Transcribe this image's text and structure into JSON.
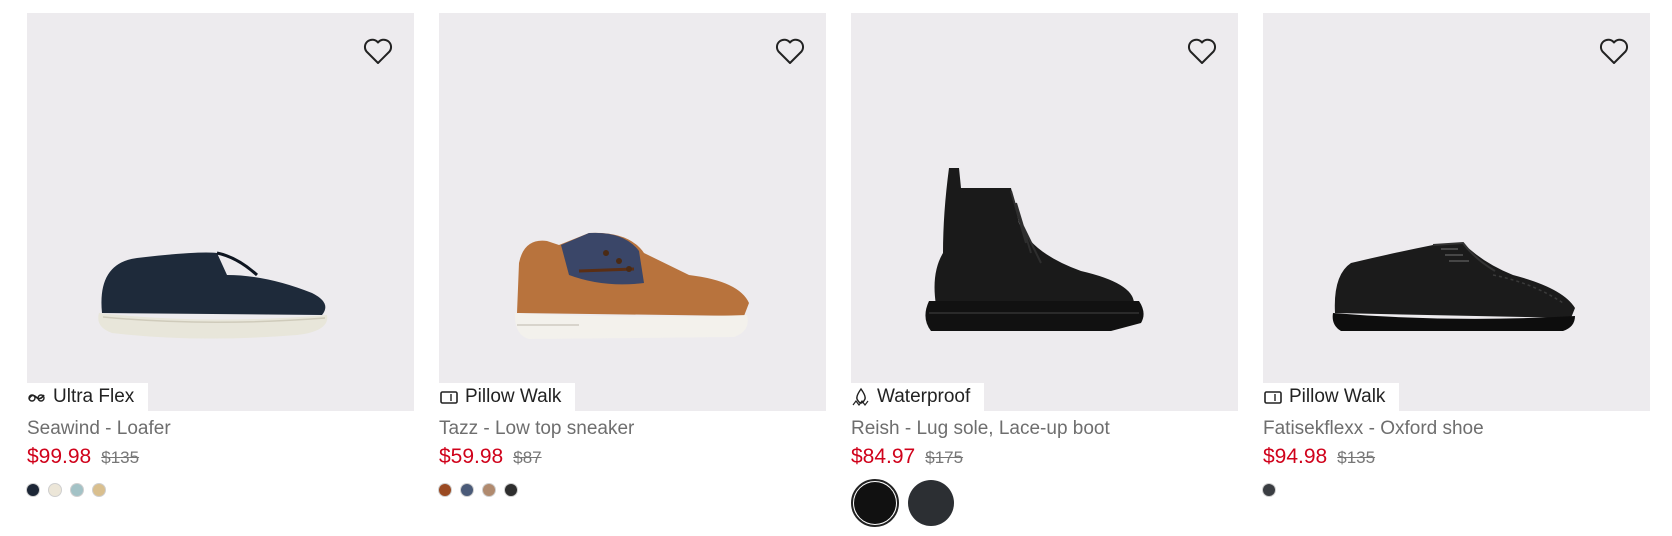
{
  "products": [
    {
      "badge": "Ultra Flex",
      "badge_icon": "flex-icon",
      "name": "Seawind - Loafer",
      "sale_price": "$99.98",
      "original_price": "$135",
      "swatch_colors": [
        "#1c2636",
        "#ece6d8",
        "#a3c2c6",
        "#d9bf8e"
      ]
    },
    {
      "badge": "Pillow Walk",
      "badge_icon": "pillow-icon",
      "name": "Tazz - Low top sneaker",
      "sale_price": "$59.98",
      "original_price": "$87",
      "swatch_colors": [
        "#9a4a22",
        "#4a5a78",
        "#b08a6e",
        "#2e2e2e"
      ]
    },
    {
      "badge": "Waterproof",
      "badge_icon": "waterproof-icon",
      "name": "Reish - Lug sole, Lace-up boot",
      "sale_price": "$84.97",
      "original_price": "$175",
      "swatch_colors": [
        "#111111",
        "#2c2f33"
      ]
    },
    {
      "badge": "Pillow Walk",
      "badge_icon": "pillow-icon",
      "name": "Fatisekflexx - Oxford shoe",
      "sale_price": "$94.98",
      "original_price": "$135",
      "swatch_colors": [
        "#3a3d42"
      ]
    }
  ],
  "colors": {
    "sale": "#d0021b",
    "media_bg": "#edebee"
  }
}
